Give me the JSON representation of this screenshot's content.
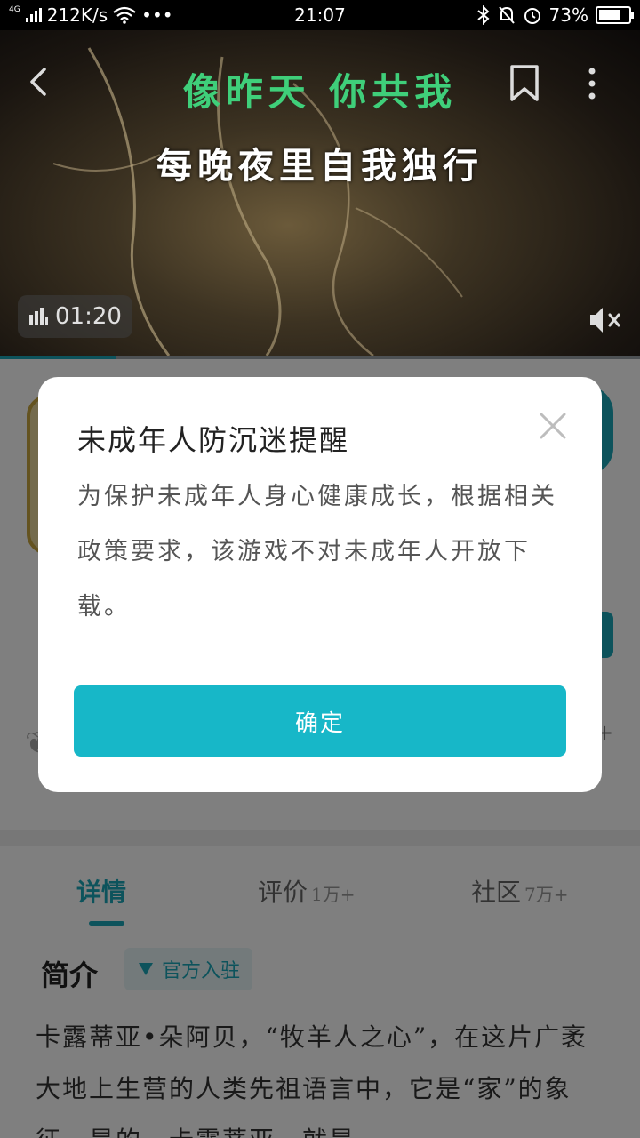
{
  "status_bar": {
    "network_label": "4G",
    "speed": "212K/s",
    "dots": "•••",
    "time": "21:07",
    "battery_percent": "73%",
    "battery_level": 0.73
  },
  "video": {
    "lyric_line1": "像昨天 你共我",
    "lyric_line2": "每晚夜里自我独行",
    "duration": "01:20",
    "progress": 0.18
  },
  "dialog": {
    "title": "未成年人防沉迷提醒",
    "body": "为保护未成年人身心健康成长，根据相关政策要求，该游戏不对未成年人开放下载。",
    "confirm_label": "确定"
  },
  "tabs": [
    {
      "label": "详情",
      "count": ""
    },
    {
      "label": "评价",
      "count": "1万+"
    },
    {
      "label": "社区",
      "count": "7万+"
    }
  ],
  "intro": {
    "title": "简介",
    "badge": "官方入驻",
    "text": "卡露蒂亚•朵阿贝，“牧羊人之心”，在这片广袤大地上生营的人类先祖语言中，它是“家”的象征，是的，卡露蒂亚，就是"
  },
  "colors": {
    "accent": "#17b7c8",
    "lyric_green": "#3fcf7a"
  }
}
